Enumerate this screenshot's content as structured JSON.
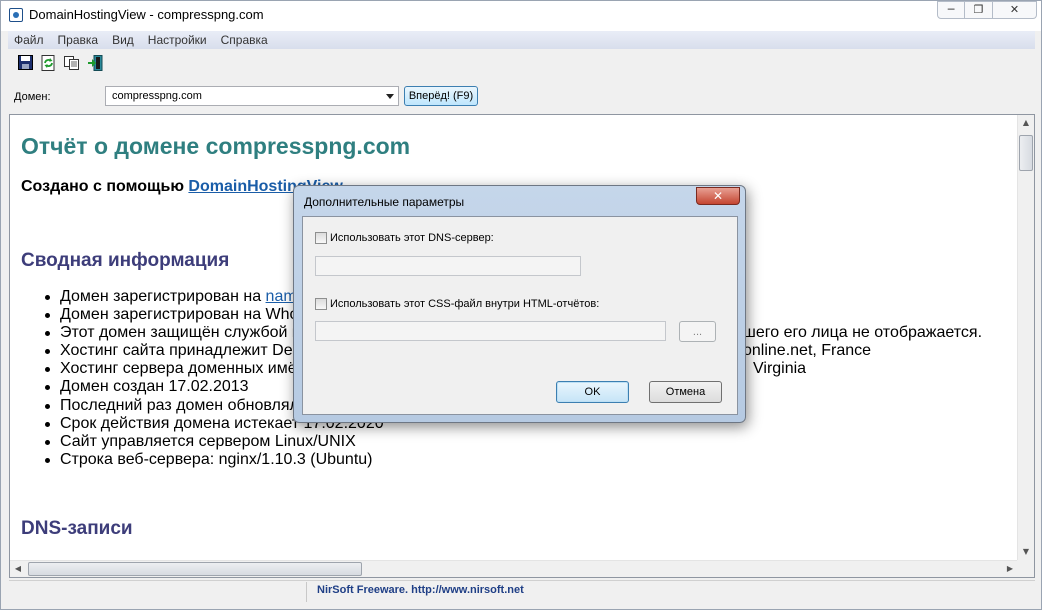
{
  "window": {
    "title": "DomainHostingView  -  compresspng.com",
    "minimize_glyph": "─",
    "restore_glyph": "❐",
    "close_glyph": "✕"
  },
  "menu": [
    "Файл",
    "Правка",
    "Вид",
    "Настройки",
    "Справка"
  ],
  "toolbar": {
    "icons": [
      "save-icon",
      "refresh-icon",
      "copy-icon",
      "exit-icon"
    ]
  },
  "domain_row": {
    "label": "Домен:",
    "value": "compresspng.com",
    "go_label": "Вперёд! (F9)"
  },
  "report": {
    "heading": "Отчёт о домене compresspng.com",
    "created_prefix": "Создано с помощью ",
    "created_link": "DomainHostingView",
    "summary_heading": "Сводная информация",
    "summary_items": [
      {
        "pre": "Домен зарегистрирован на ",
        "link": "name",
        "post": ""
      },
      {
        "pre": "Домен зарегистрирован на Whoi",
        "link": "",
        "post": ""
      },
      {
        "pre": "Этот домен защищён службой ко",
        "link": "",
        "post": "                                                    шего его лица не отображается."
      },
      {
        "pre": "Хостинг сайта принадлежит Dedi",
        "link": "",
        "post": "                                                    online.net, France"
      },
      {
        "pre": "Хостинг сервера доменных имён",
        "link": "",
        "post": "                                                     Virginia"
      },
      {
        "pre": "Домен создан 17.02.2013",
        "link": "",
        "post": ""
      },
      {
        "pre": "Последний раз домен обновлялс",
        "link": "",
        "post": ""
      },
      {
        "pre": "Срок действия домена истекает 17.02.2020",
        "link": "",
        "post": ""
      },
      {
        "pre": "Сайт управляется сервером Linux/UNIX",
        "link": "",
        "post": ""
      },
      {
        "pre": "Строка веб-сервера: nginx/1.10.3 (Ubuntu)",
        "link": "",
        "post": ""
      }
    ],
    "dns_heading": "DNS-записи"
  },
  "statusbar": {
    "text": "NirSoft Freeware.  http://www.nirsoft.net"
  },
  "dialog": {
    "title": "Дополнительные параметры",
    "close_glyph": "✕",
    "dns_checkbox_label": "Использовать этот DNS-сервер:",
    "dns_checked": false,
    "dns_value": "",
    "css_checkbox_label": "Использовать этот CSS-файл внутри HTML-отчётов:",
    "css_checked": false,
    "css_value": "",
    "browse_label": "...",
    "ok_label": "OK",
    "cancel_label": "Отмена"
  },
  "colors": {
    "heading_teal": "#2f7f80",
    "heading_navy": "#3d3d7a",
    "link_blue": "#1a5da8",
    "status_text": "#1f3f86"
  }
}
